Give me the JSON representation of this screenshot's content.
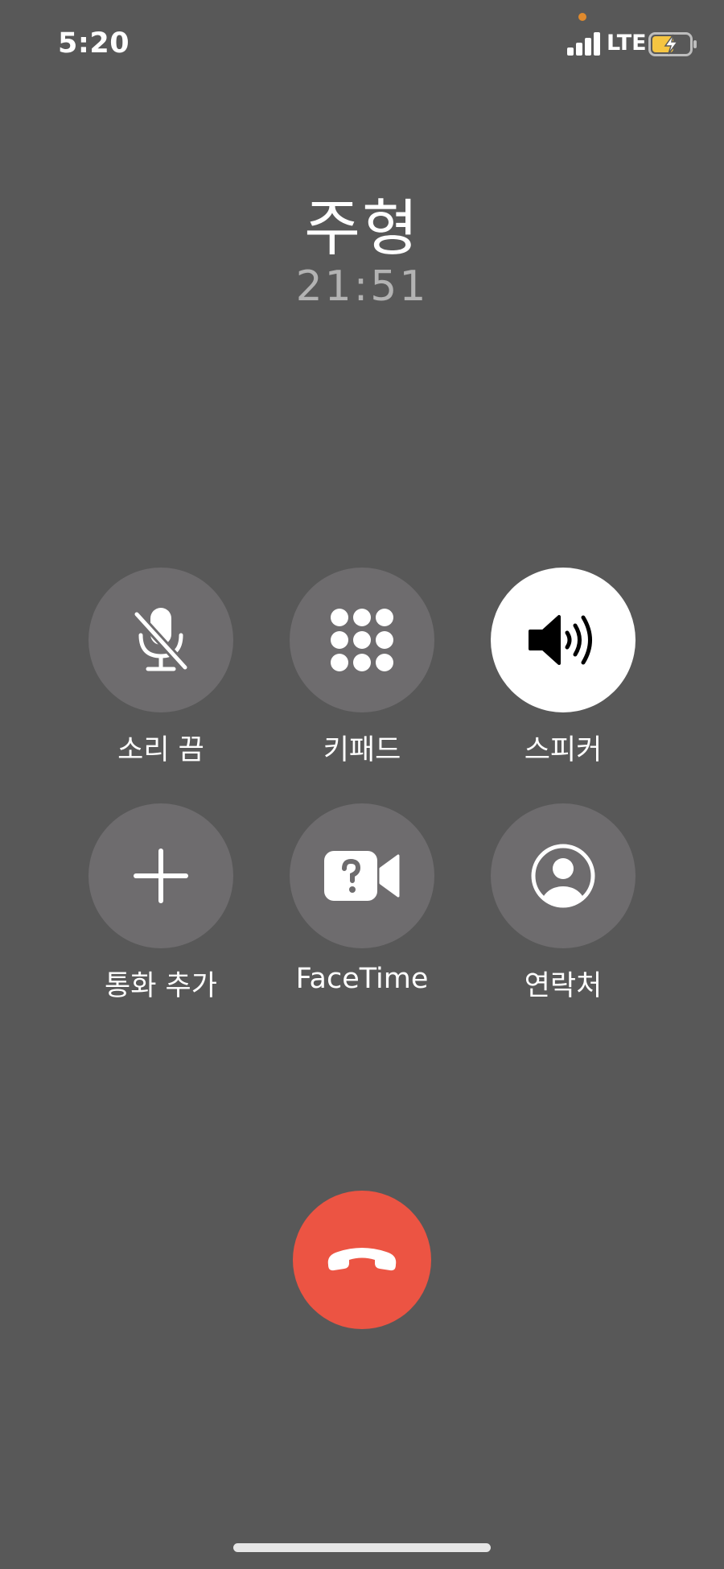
{
  "status_bar": {
    "time": "5:20",
    "network": "LTE",
    "signal_bars": 4,
    "battery_icon": "battery-charging-icon",
    "battery_color": "#f5c542",
    "privacy_dot_color": "#e08a2d"
  },
  "caller": {
    "name": "주형",
    "duration": "21:51"
  },
  "controls": [
    {
      "label": "소리 끔",
      "icon": "mic-mute-icon",
      "active": false
    },
    {
      "label": "키패드",
      "icon": "keypad-icon",
      "active": false
    },
    {
      "label": "스피커",
      "icon": "speaker-icon",
      "active": true
    },
    {
      "label": "통화 추가",
      "icon": "plus-icon",
      "active": false
    },
    {
      "label": "FaceTime",
      "icon": "facetime-icon",
      "active": false
    },
    {
      "label": "연락처",
      "icon": "contact-icon",
      "active": false
    }
  ],
  "end_call": {
    "icon": "end-call-icon",
    "color": "#ec5443"
  },
  "colors": {
    "background": "#585858",
    "control_bg": "#6e6c6e",
    "control_active_bg": "#ffffff"
  }
}
